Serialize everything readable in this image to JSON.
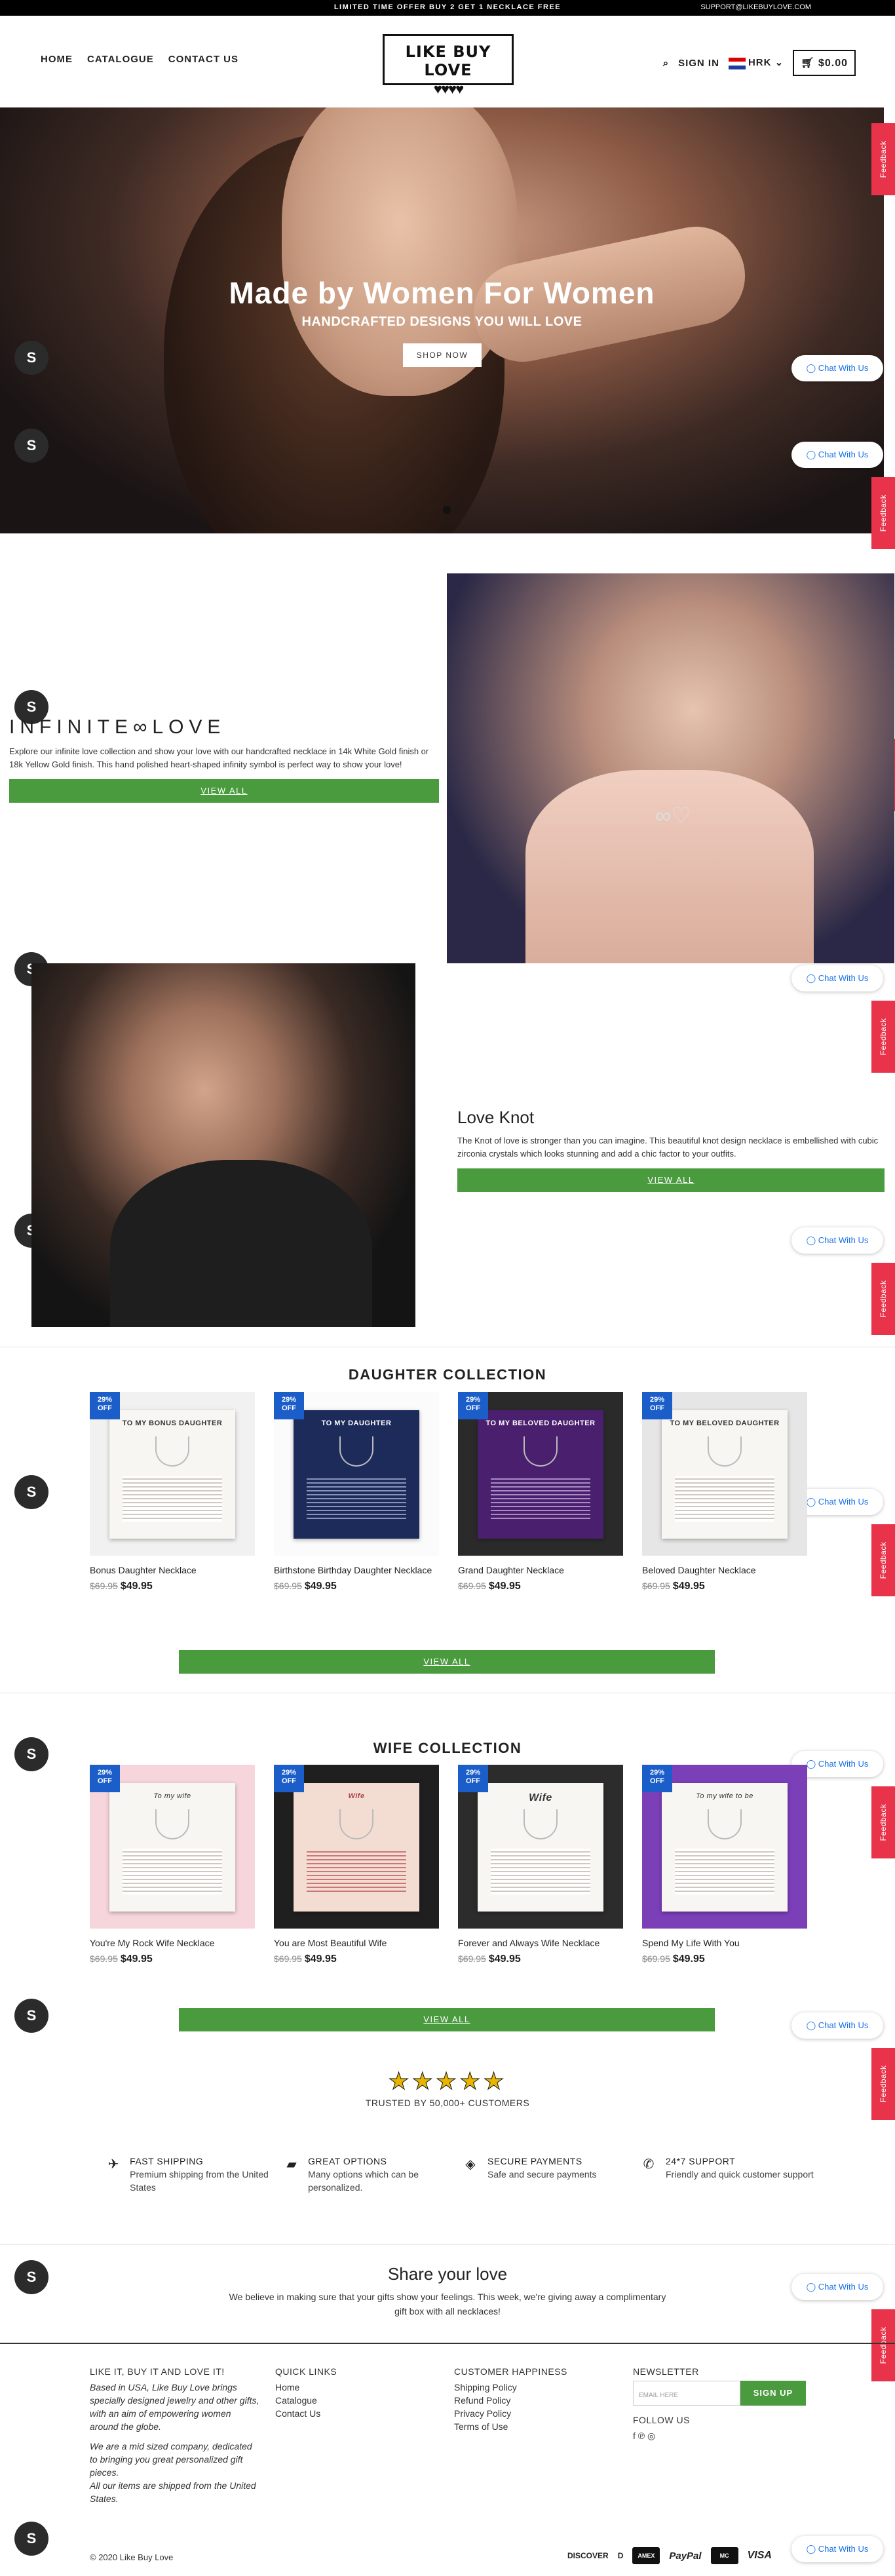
{
  "topbar": {
    "message": "LIMITED TIME OFFER BUY 2 GET 1 NECKLACE FREE",
    "email": "SUPPORT@LIKEBUYLOVE.COM"
  },
  "nav": {
    "home": "HOME",
    "catalogue": "CATALOGUE",
    "contact": "CONTACT US"
  },
  "logo": {
    "text": "LIKE BUY LOVE",
    "hearts": "♥♥♥♥"
  },
  "header": {
    "sign_in": "SIGN IN",
    "currency": "HRK",
    "cart": "$0.00"
  },
  "hero": {
    "title": "Made by Women For Women",
    "subtitle": "HANDCRAFTED DESIGNS YOU WILL LOVE",
    "button": "SHOP NOW"
  },
  "widgets": {
    "chat": "Chat With Us",
    "feedback": "Feedback",
    "shop_glyph": "S"
  },
  "infinite": {
    "title": "INFINITE∞LOVE",
    "text": "Explore our infinite love collection and show your love with our handcrafted necklace in 14k White Gold finish or 18k Yellow Gold finish. This hand polished heart-shaped infinity symbol is perfect way to show your love!",
    "button": "VIEW ALL"
  },
  "knot": {
    "title": "Love Knot",
    "text": "The Knot of love is stronger than you can imagine. This beautiful knot design necklace is embellished with cubic zirconia crystals which looks stunning and add a chic factor to your outfits.",
    "button": "VIEW ALL"
  },
  "daughter": {
    "title": "DAUGHTER COLLECTION",
    "button": "VIEW ALL",
    "products": [
      {
        "badge": "29% OFF",
        "card": "TO MY BONUS DAUGHTER",
        "name": "Bonus Daughter Necklace",
        "old": "$69.95",
        "price": "$49.95",
        "bg": "#f1f1f1"
      },
      {
        "badge": "29% OFF",
        "card": "TO MY DAUGHTER",
        "name": "Birthstone Birthday Daughter Necklace",
        "old": "$69.95",
        "price": "$49.95",
        "bg": "#fbfbfb"
      },
      {
        "badge": "29% OFF",
        "card": "TO MY BELOVED DAUGHTER",
        "name": "Grand Daughter Necklace",
        "old": "$69.95",
        "price": "$49.95",
        "bg": "#2a2a2a"
      },
      {
        "badge": "29% OFF",
        "card": "TO MY BELOVED DAUGHTER",
        "name": "Beloved Daughter Necklace",
        "old": "$69.95",
        "price": "$49.95",
        "bg": "#e6e6e6"
      }
    ]
  },
  "wife": {
    "title": "WIFE COLLECTION",
    "button": "VIEW ALL",
    "products": [
      {
        "badge": "29% OFF",
        "card": "To my wife",
        "name": "You're My Rock Wife Necklace",
        "old": "$69.95",
        "price": "$49.95",
        "bg": "#f6d6dc"
      },
      {
        "badge": "29% OFF",
        "card": "Wife",
        "name": "You are Most Beautiful Wife",
        "old": "$69.95",
        "price": "$49.95",
        "bg": "#1f1f1f"
      },
      {
        "badge": "29% OFF",
        "card": "Wife",
        "name": "Forever and Always Wife Necklace",
        "old": "$69.95",
        "price": "$49.95",
        "bg": "#2c2c2c"
      },
      {
        "badge": "29% OFF",
        "card": "To my wife to be",
        "name": "Spend My Life With You",
        "old": "$69.95",
        "price": "$49.95",
        "bg": "#7b3fb8"
      }
    ]
  },
  "trust": {
    "stars": "★★★★★",
    "label": "TRUSTED BY 50,000+ CUSTOMERS"
  },
  "features": [
    {
      "icon": "airplane-icon",
      "glyph": "✈",
      "title": "FAST SHIPPING",
      "desc": "Premium shipping from the United States"
    },
    {
      "icon": "bag-icon",
      "glyph": "▰",
      "title": "GREAT OPTIONS",
      "desc": "Many options which can be personalized."
    },
    {
      "icon": "shield-icon",
      "glyph": "◈",
      "title": "SECURE PAYMENTS",
      "desc": "Safe and secure payments"
    },
    {
      "icon": "phone-icon",
      "glyph": "✆",
      "title": "24*7 SUPPORT",
      "desc": "Friendly and quick customer support"
    }
  ],
  "share": {
    "title": "Share your love",
    "text": "We believe in making sure that your gifts show your feelings. This week, we're giving away a complimentary gift box with all necklaces!"
  },
  "footer": {
    "about_title": "LIKE IT, BUY IT AND LOVE IT!",
    "about_1": "Based in USA, Like Buy Love brings specially designed jewelry and other gifts, with an aim of empowering women around the globe.",
    "about_2": "We are a mid sized company, dedicated to bringing you great personalized gift pieces.",
    "about_3": "All our items are shipped from the United States.",
    "quick_title": "QUICK LINKS",
    "quick_links": [
      "Home",
      "Catalogue",
      "Contact Us"
    ],
    "happy_title": "CUSTOMER HAPPINESS",
    "happy_links": [
      "Shipping Policy",
      "Refund Policy",
      "Privacy Policy",
      "Terms of Use"
    ],
    "news_title": "NEWSLETTER",
    "news_placeholder": "EMAIL HERE",
    "news_button": "SIGN UP",
    "follow": "FOLLOW US",
    "social": "f  ℗  ◎",
    "copyright": "© 2020 Like Buy Love",
    "payments": [
      "DISCOVER",
      "D",
      "AMEX",
      "PayPal",
      "MC",
      "VISA"
    ]
  },
  "colors": {
    "accent_green": "#4a9a3e",
    "badge_blue": "#1b5ec9",
    "feedback_red": "#e8334a",
    "chat_blue": "#1a73e8"
  }
}
